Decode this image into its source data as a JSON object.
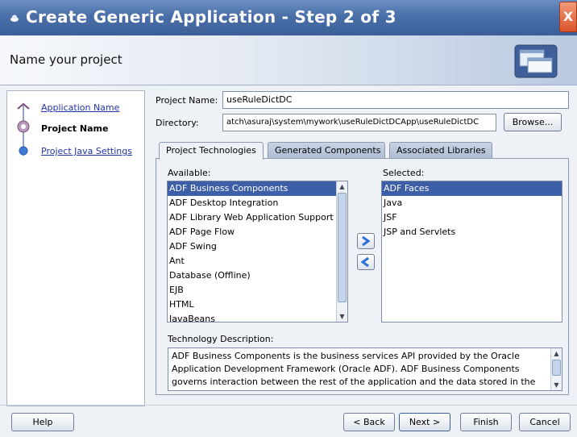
{
  "window": {
    "title": "Create Generic Application - Step 2 of 3",
    "close_glyph": "X",
    "subtitle": "Name your project"
  },
  "nav": {
    "items": [
      {
        "label": "Application Name",
        "state": "link"
      },
      {
        "label": "Project Name",
        "state": "current"
      },
      {
        "label": "Project Java Settings",
        "state": "link"
      }
    ]
  },
  "form": {
    "project_name_label": "Project Name:",
    "project_name_value": "useRuleDictDC",
    "directory_label": "Directory:",
    "directory_value": "atch\\asuraj\\system\\mywork\\useRuleDictDCApp\\useRuleDictDC",
    "browse_label": "Browse..."
  },
  "tabs": [
    {
      "label": "Project Technologies",
      "active": true
    },
    {
      "label": "Generated Components",
      "active": false
    },
    {
      "label": "Associated Libraries",
      "active": false
    }
  ],
  "available": {
    "label": "Available:",
    "items": [
      "ADF Business Components",
      "ADF Desktop Integration",
      "ADF Library Web Application Support",
      "ADF Page Flow",
      "ADF Swing",
      "Ant",
      "Database (Offline)",
      "EJB",
      "HTML",
      "JavaBeans"
    ],
    "selected_index": 0
  },
  "selected": {
    "label": "Selected:",
    "items": [
      "ADF Faces",
      "Java",
      "JSF",
      "JSP and Servlets"
    ],
    "selected_index": 0
  },
  "shuttle": {
    "add_icon": "arrow-right-icon",
    "remove_icon": "arrow-left-icon"
  },
  "description": {
    "label": "Technology Description:",
    "text": "ADF Business Components is the business services API provided by the Oracle Application Development Framework (Oracle ADF).  ADF Business Components governs interaction between the rest of the application and the data stored in the"
  },
  "footer": {
    "help": "Help",
    "back": "< Back",
    "next": "Next >",
    "finish": "Finish",
    "cancel": "Cancel"
  },
  "colors": {
    "title_bar": "#4a6fa8",
    "selection": "#3d5fa8",
    "link": "#2233aa"
  }
}
